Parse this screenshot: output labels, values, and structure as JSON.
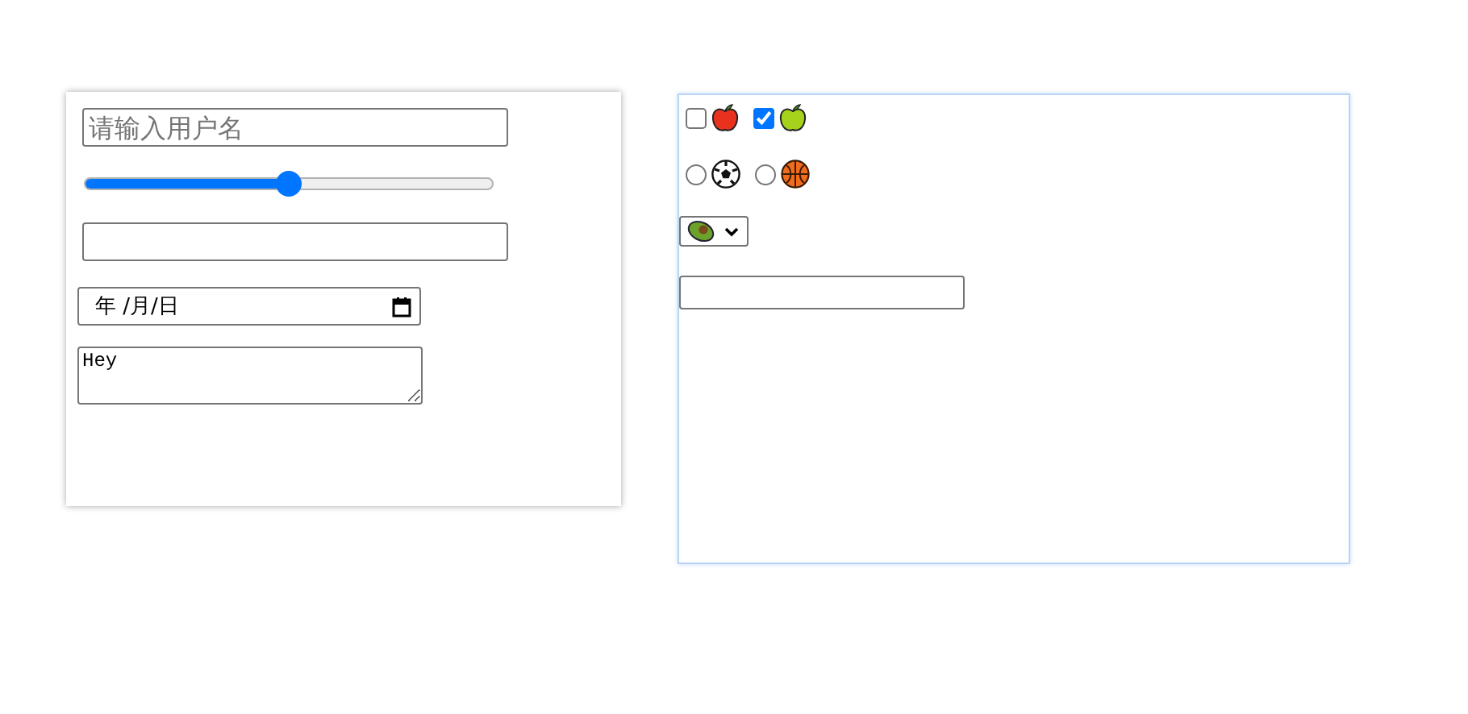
{
  "left_form": {
    "username": {
      "placeholder": "请输入用户名"
    },
    "slider": {
      "level": 0.5
    },
    "date": {
      "placeholder": "年 /月/日"
    },
    "textarea": {
      "value": "Hey"
    }
  },
  "right_form": {
    "checkboxes": [
      {
        "kind": "red_apple",
        "checked": false
      },
      {
        "kind": "green_apple",
        "checked": true
      }
    ],
    "radios": [
      {
        "kind": "soccer",
        "selected": false
      },
      {
        "kind": "basketball",
        "selected": false
      }
    ],
    "select": {
      "kind": "avocado"
    }
  }
}
